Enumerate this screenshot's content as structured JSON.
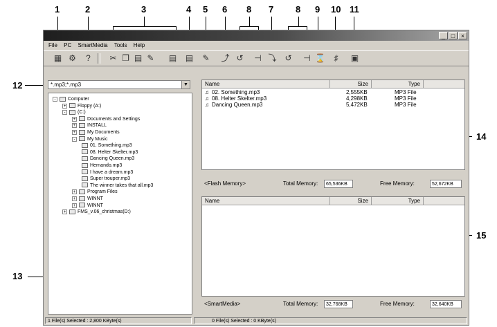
{
  "callouts": [
    "1",
    "2",
    "3",
    "4",
    "5",
    "6",
    "8",
    "7",
    "8",
    "9",
    "10",
    "11",
    "12",
    "13",
    "14",
    "15"
  ],
  "window": {
    "buttons": [
      "_",
      "□",
      "×"
    ],
    "menu": [
      "File",
      "PC",
      "SmartMedia",
      "Tools",
      "Help"
    ],
    "toolbar_icons": [
      "card-icon",
      "format-icon",
      "help-icon",
      "cut-icon",
      "copy-icon",
      "paste-icon",
      "rename-icon",
      "properties-icon",
      "view-icon",
      "delete-icon",
      "upload-icon",
      "skip-icon",
      "next-icon",
      "download-icon",
      "skip2-icon",
      "next2-icon",
      "clear-icon",
      "star-icon",
      "save-icon"
    ]
  },
  "filter": {
    "value": "*.mp3;*.mp3"
  },
  "tree": [
    {
      "label": "Computer",
      "level": 0,
      "toggle": "-"
    },
    {
      "label": "Floppy (A:)",
      "level": 1,
      "toggle": "+"
    },
    {
      "label": "(C:)",
      "level": 1,
      "toggle": "-"
    },
    {
      "label": "Documents and Settings",
      "level": 2,
      "toggle": "+"
    },
    {
      "label": "INSTALL",
      "level": 2,
      "toggle": "+"
    },
    {
      "label": "My Documents",
      "level": 2,
      "toggle": "+"
    },
    {
      "label": "My Music",
      "level": 2,
      "toggle": "-"
    },
    {
      "label": "01. Something.mp3",
      "level": 3,
      "toggle": ""
    },
    {
      "label": "08. Helter Skelter.mp3",
      "level": 3,
      "toggle": ""
    },
    {
      "label": "Dancing Queen.mp3",
      "level": 3,
      "toggle": ""
    },
    {
      "label": "Hernando.mp3",
      "level": 3,
      "toggle": ""
    },
    {
      "label": "I have a dream.mp3",
      "level": 3,
      "toggle": ""
    },
    {
      "label": "Super trouper.mp3",
      "level": 3,
      "toggle": ""
    },
    {
      "label": "The winner takes that all.mp3",
      "level": 3,
      "toggle": ""
    },
    {
      "label": "Program Files",
      "level": 2,
      "toggle": "+"
    },
    {
      "label": "WINNT",
      "level": 2,
      "toggle": "+"
    },
    {
      "label": "WINNT",
      "level": 2,
      "toggle": "+"
    },
    {
      "label": "FMS_v.06_christmas(D:)",
      "level": 1,
      "toggle": "+"
    }
  ],
  "flash_panel": {
    "columns": [
      "Name",
      "Size",
      "Type"
    ],
    "rows": [
      {
        "name": "02. Something.mp3",
        "size": "2,555KB",
        "type": "MP3 File"
      },
      {
        "name": "08. Helter Skelter.mp3",
        "size": "4,298KB",
        "type": "MP3 File"
      },
      {
        "name": "Dancing Queen.mp3",
        "size": "5,472KB",
        "type": "MP3 File"
      }
    ],
    "label": "<Flash Memory>",
    "total_label": "Total Memory:",
    "total_value": "65,536KB",
    "free_label": "Free Memory:",
    "free_value": "52,672KB"
  },
  "smart_panel": {
    "columns": [
      "Name",
      "Size",
      "Type"
    ],
    "label": "<SmartMedia>",
    "total_label": "Total Memory:",
    "total_value": "32,768KB",
    "free_label": "Free Memory:",
    "free_value": "32,640KB"
  },
  "statusbar": {
    "left": "1 File(s) Selected : 2,800 KByte(s)",
    "right": "0 File(s) Selected : 0 KByte(s)"
  }
}
